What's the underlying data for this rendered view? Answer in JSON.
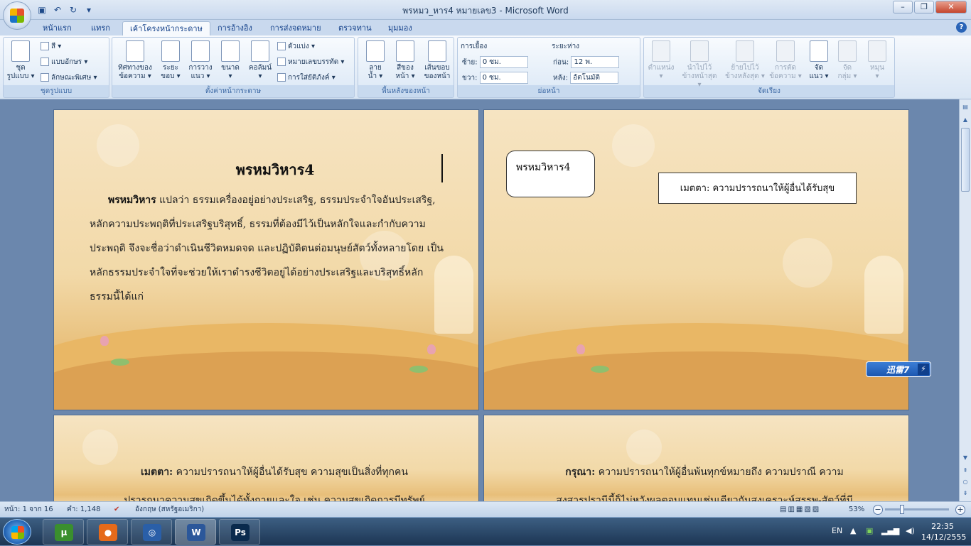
{
  "window": {
    "title": "พรหมว_หาร4 หมายเลข3 - Microsoft Word",
    "controls": [
      "–",
      "❐",
      "✕"
    ]
  },
  "qat": {
    "save_icon": "floppy-disk-icon",
    "undo_icon": "undo-icon",
    "redo_icon": "redo-icon",
    "customize_icon": "customize-qat-icon"
  },
  "tabs": [
    {
      "label": "หน้าแรก"
    },
    {
      "label": "แทรก"
    },
    {
      "label": "เค้าโครงหน้ากระดาษ",
      "active": true
    },
    {
      "label": "การอ้างอิง"
    },
    {
      "label": "การส่งจดหมาย"
    },
    {
      "label": "ตรวจทาน"
    },
    {
      "label": "มุมมอง"
    }
  ],
  "ribbon": {
    "themes": {
      "label": "ชุดรูปแบบ",
      "big": "ชุด\nรูปแบบ ▾",
      "colors": "สี ▾",
      "fonts": "แบบอักษร ▾",
      "effects": "ลักษณะพิเศษ ▾"
    },
    "page_setup": {
      "label": "ตั้งค่าหน้ากระดาษ",
      "text_direction": "ทิศทางของ\nข้อความ ▾",
      "margins": "ระยะ\nขอบ ▾",
      "orientation": "การวาง\nแนว ▾",
      "size": "ขนาด\n▾",
      "columns": "คอลัมน์\n▾",
      "breaks": "ตัวแบ่ง ▾",
      "line_numbers": "หมายเลขบรรทัด ▾",
      "hyphenation": "การใส่ยัติภังค์ ▾"
    },
    "page_background": {
      "label": "พื้นหลังของหน้า",
      "watermark": "ลาย\nน้ำ ▾",
      "page_color": "สีของ\nหน้า ▾",
      "page_borders": "เส้นขอบ\nของหน้า"
    },
    "paragraph": {
      "label": "ย่อหน้า",
      "indent_title": "การเยื้อง",
      "indent_left_label": "ซ้าย:",
      "indent_left_value": "0 ซม.",
      "indent_right_label": "ขวา:",
      "indent_right_value": "0 ซม.",
      "spacing_title": "ระยะห่าง",
      "spacing_before_label": "ก่อน:",
      "spacing_before_value": "12 พ.",
      "spacing_after_label": "หลัง:",
      "spacing_after_value": "อัตโนมัติ"
    },
    "arrange": {
      "label": "จัดเรียง",
      "position": "ตำแหน่ง\n▾",
      "bring_front": "นำไปไว้\nข้างหน้าสุด ▾",
      "send_back": "ย้ายไปไว้\nข้างหลังสุด ▾",
      "text_wrap": "การตัด\nข้อความ ▾",
      "align": "จัด\nแนว ▾",
      "group": "จัด\nกลุ่ม ▾",
      "rotate": "หมุน\n▾"
    }
  },
  "document": {
    "page1": {
      "title": "พรหมวิหาร4",
      "lead_bold": "พรหมวิหาร",
      "body": " แปลว่า ธรรมเครื่องอยู่อย่างประเสริฐ, ธรรมประจำใจอันประเสริฐ, หลักความประพฤติที่ประเสริฐบริสุทธิ์, ธรรมที่ต้องมีไว้เป็นหลักใจและกำกับความประพฤติ จึงจะชื่อว่าดำเนินชีวิตหมดจด และปฏิบัติตนต่อมนุษย์สัตว์ทั้งหลายโดย เป็นหลักธรรมประจำใจที่จะช่วยให้เราดำรงชีวิตอยู่ได้อย่างประเสริฐและบริสุทธิ์หลักธรรมนี้ได้แก่"
    },
    "page2": {
      "shape1": "พรหมวิหาร4",
      "shape2": "เมตตา: ความปรารถนาให้ผู้อื่นได้รับสุข"
    },
    "page3": {
      "lead_bold": "เมตตา:",
      "line1": " ความปรารถนาให้ผู้อื่นได้รับสุข ความสุขเป็นสิ่งที่ทุกคน",
      "line2": "ปรารถนาความสุขเกิดขึ้นได้ทั้งกายและใจ เช่น ความสุขเกิดการมีทรัพย์"
    },
    "page4": {
      "lead_bold": "กรุณา:",
      "line1": " ความปรารถนาให้ผู้อื่นพ้นทุกข์หมายถึง ความปราณี       ความ",
      "line2": "สงสารปรานีนี้ก็ไม่หวังผลตอบแทนเช่นเดียวกันสงเคราะห์สรรพ-สัตว์ที่มี"
    }
  },
  "overlay": {
    "xunlei_label": "迅雷7",
    "xunlei_bolt": "⚡"
  },
  "statusbar": {
    "page": "หน้า: 1 จาก 16",
    "words": "คำ: 1,148",
    "language": "อังกฤษ (สหรัฐอเมริกา)",
    "zoom": "53%",
    "zoom_level": 0.53
  },
  "taskbar": {
    "apps": [
      {
        "name": "utorrent-icon",
        "glyph": "µ",
        "color": "#3a8f2e"
      },
      {
        "name": "firefox-icon",
        "glyph": "●",
        "color": "#e56a1a"
      },
      {
        "name": "network-globe-icon",
        "glyph": "◎",
        "color": "#2a5fa8"
      },
      {
        "name": "word-icon",
        "glyph": "W",
        "color": "#2b579a",
        "active": true
      },
      {
        "name": "photoshop-icon",
        "glyph": "Ps",
        "color": "#0a2a4d"
      }
    ],
    "language": "EN",
    "time": "22:35",
    "date": "14/12/2555"
  }
}
